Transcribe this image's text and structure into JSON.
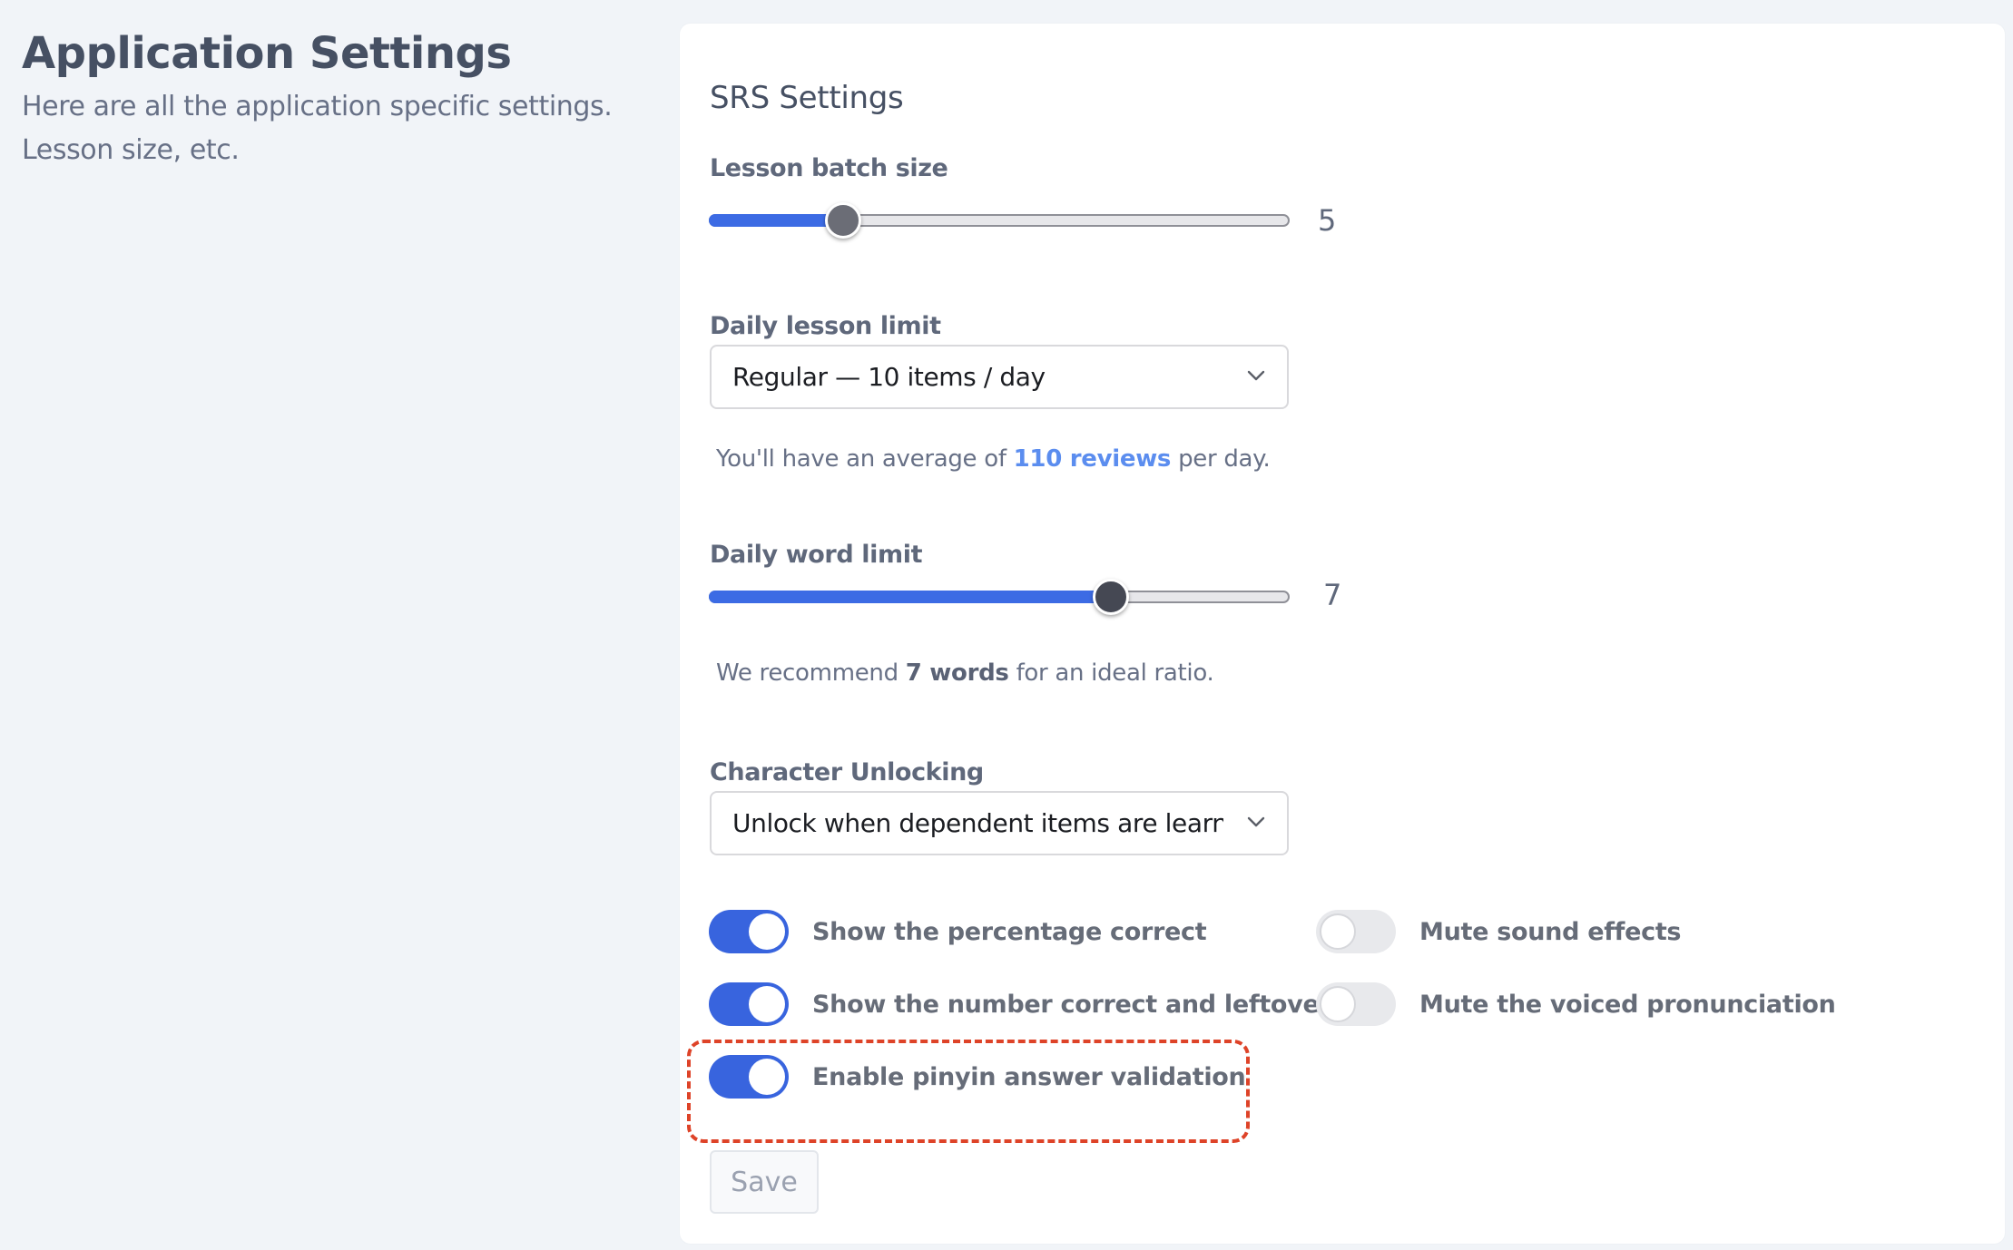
{
  "page": {
    "title": "Application Settings",
    "description": "Here are all the application specific settings. Lesson size, etc."
  },
  "card": {
    "title": "SRS Settings",
    "lesson_batch_size": {
      "label": "Lesson batch size",
      "value": "5",
      "fill_fraction": 0.23
    },
    "daily_lesson_limit": {
      "label": "Daily lesson limit",
      "selected": "Regular — 10 items / day",
      "helper_prefix": "You'll have an average of ",
      "helper_link": "110 reviews",
      "helper_suffix": " per day."
    },
    "daily_word_limit": {
      "label": "Daily word limit",
      "value": "7",
      "fill_fraction": 0.69,
      "helper_prefix": "We recommend ",
      "helper_strong": "7 words",
      "helper_suffix": " for an ideal ratio."
    },
    "character_unlocking": {
      "label": "Character Unlocking",
      "selected": "Unlock when dependent items are learned"
    },
    "toggles": [
      {
        "label": "Show the percentage correct",
        "on": true
      },
      {
        "label": "Show the number correct and leftover",
        "on": true
      },
      {
        "label": "Enable pinyin answer validation",
        "on": true,
        "highlighted": true
      },
      {
        "label": "Mute sound effects",
        "on": false
      },
      {
        "label": "Mute the voiced pronunciation",
        "on": false
      }
    ],
    "save_label": "Save"
  },
  "colors": {
    "accent": "#3864de",
    "link": "#5b8def",
    "highlight": "#de4328",
    "background": "#f1f4f8"
  }
}
